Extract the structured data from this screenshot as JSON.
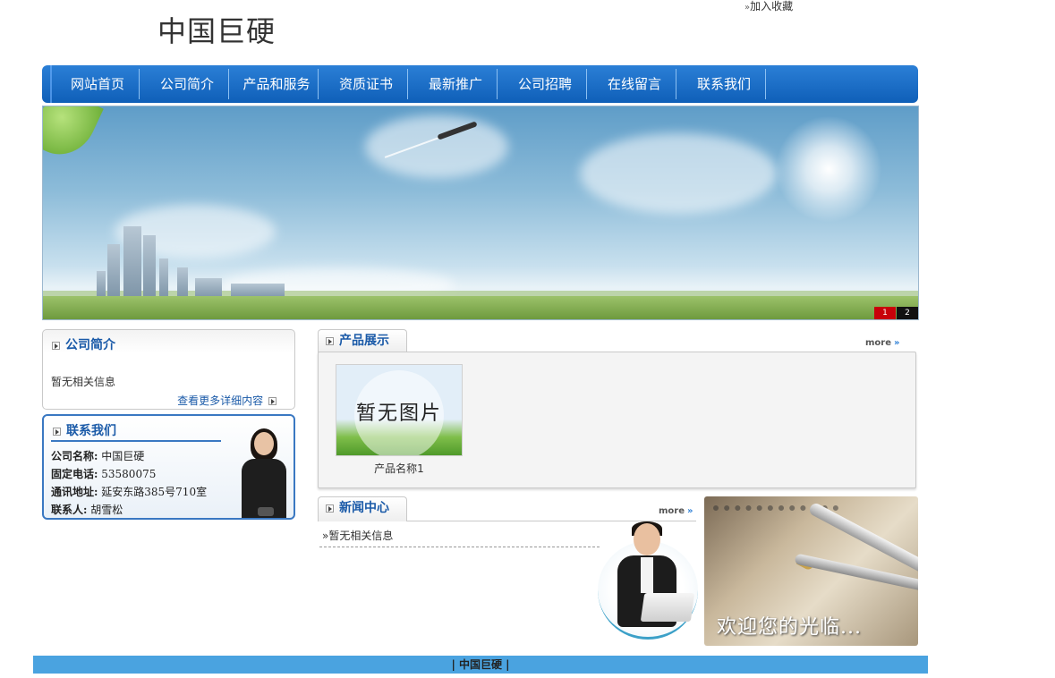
{
  "header": {
    "logo_text": "中国巨硬",
    "favorite_link": "加入收藏",
    "favorite_arrow": "»"
  },
  "nav": {
    "items": [
      {
        "label": "网站首页"
      },
      {
        "label": "公司简介"
      },
      {
        "label": "产品和服务"
      },
      {
        "label": "资质证书"
      },
      {
        "label": "最新推广"
      },
      {
        "label": "公司招聘"
      },
      {
        "label": "在线留言"
      },
      {
        "label": "联系我们"
      }
    ]
  },
  "banner": {
    "slides": [
      "1",
      "2"
    ],
    "active_slide": "1"
  },
  "about": {
    "title": "公司简介",
    "text": "暂无相关信息",
    "more_label": "查看更多详细内容"
  },
  "contact": {
    "title": "联系我们",
    "rows": [
      {
        "label": "公司名称:",
        "value": "中国巨硬"
      },
      {
        "label": "固定电话:",
        "value": "53580075"
      },
      {
        "label": "通讯地址:",
        "value": "延安东路385号710室"
      },
      {
        "label": "联系人:",
        "value": "胡雪松"
      }
    ]
  },
  "products": {
    "title": "产品展示",
    "more_label": "more",
    "items": [
      {
        "image_caption": "暂无图片",
        "name": "产品名称1"
      }
    ]
  },
  "news": {
    "title": "新闻中心",
    "more_label": "more",
    "items": [
      {
        "text": "»暂无相关信息"
      }
    ]
  },
  "welcome": {
    "text": "欢迎您的光临..."
  },
  "footer": {
    "text": "| 中国巨硬 |"
  },
  "colors": {
    "nav_bg": "#1560bd",
    "accent_blue": "#1a5aa8",
    "footer_bg": "#4aa3e0",
    "active_slide": "#c8000a"
  }
}
